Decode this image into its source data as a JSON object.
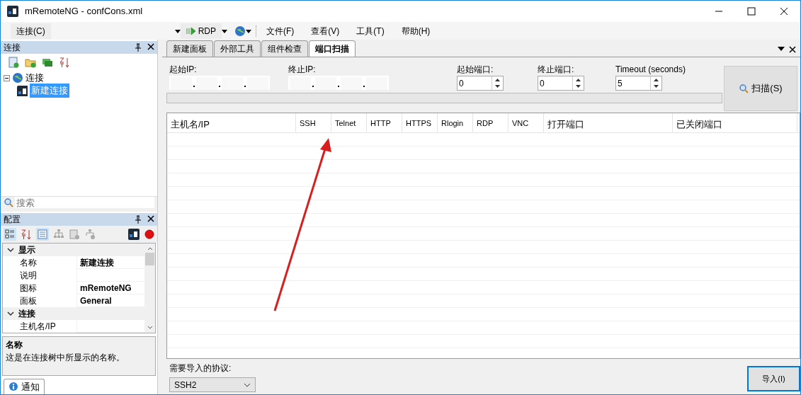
{
  "window": {
    "title": "mRemoteNG - confCons.xml"
  },
  "toolbar": {
    "connect_menu": "连接(C)",
    "protocol": "RDP",
    "menus": [
      "文件(F)",
      "查看(V)",
      "工具(T)",
      "帮助(H)"
    ]
  },
  "connections_panel": {
    "title": "连接",
    "tree": [
      {
        "label": "连接",
        "expanded": true,
        "selected": false,
        "children": [
          {
            "label": "新建连接",
            "selected": true
          }
        ]
      }
    ],
    "search": {
      "placeholder": "搜索"
    }
  },
  "config_panel": {
    "title": "配置",
    "groups": [
      {
        "label": "显示",
        "expanded": true,
        "rows": [
          {
            "name": "名称",
            "value": "新建连接"
          },
          {
            "name": "说明"
          },
          {
            "name": "图标",
            "value": "mRemoteNG"
          },
          {
            "name": "面板",
            "value": "General"
          }
        ]
      },
      {
        "label": "连接",
        "expanded": true,
        "rows": [
          {
            "name": "主机名/IP"
          }
        ]
      }
    ],
    "help_title": "名称",
    "help_text": "这是在连接树中所显示的名称。"
  },
  "tabs": [
    {
      "label": "新建面板",
      "selected": false
    },
    {
      "label": "外部工具",
      "selected": false
    },
    {
      "label": "组件检查",
      "selected": false
    },
    {
      "label": "端口扫描",
      "selected": true
    }
  ],
  "scan": {
    "start_ip_label": "起始IP:",
    "end_ip_label": "终止IP:",
    "start_port_label": "起始端口:",
    "start_port": "0",
    "end_port_label": "终止端口:",
    "end_port": "0",
    "timeout_label": "Timeout (seconds)",
    "timeout": "5",
    "scan_button": "扫描(S)",
    "progress": {
      "level": 0
    }
  },
  "table": {
    "columns": [
      "主机名/IP",
      "SSH",
      "Telnet",
      "HTTP",
      "HTTPS",
      "Rlogin",
      "RDP",
      "VNC",
      "打开端口",
      "已关闭端口"
    ]
  },
  "import": {
    "label": "需要导入的协议:",
    "protocol": "SSH2",
    "button": "导入(I)"
  },
  "status_tab": "通知"
}
